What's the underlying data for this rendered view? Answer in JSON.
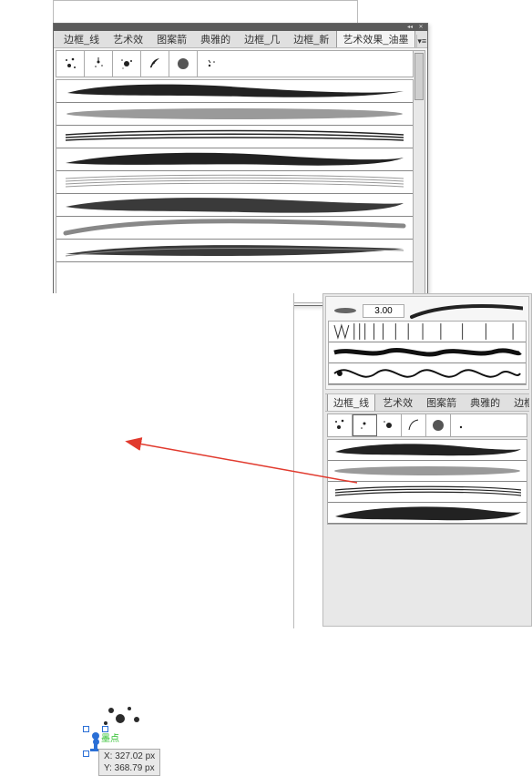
{
  "upper_panel": {
    "tabs": [
      "边框_线",
      "艺术效",
      "图案箭",
      "典雅的",
      "边框_几",
      "边框_新",
      "艺术效果_油墨"
    ],
    "active_tab_index": 6,
    "thumbs": [
      "splat-1",
      "splat-2",
      "splat-3",
      "splat-4",
      "splat-5",
      "splat-6"
    ],
    "selected_thumb_index": null
  },
  "lower_panel": {
    "size_value": "3.00",
    "tabs": [
      "边框_线",
      "艺术效",
      "图案箭",
      "典雅的",
      "边框_几",
      "边"
    ],
    "active_tab_index": 0,
    "thumbs": [
      "splat-1",
      "splat-2",
      "splat-3",
      "splat-4",
      "splat-5",
      "splat-6"
    ],
    "selected_thumb_index": 1
  },
  "symbol": {
    "label": "墨点"
  },
  "tooltip": {
    "line1": "X: 327.02 px",
    "line2": "Y: 368.79 px"
  },
  "colors": {
    "arrow": "#e13a2e",
    "accent": "#2a6fd6"
  }
}
